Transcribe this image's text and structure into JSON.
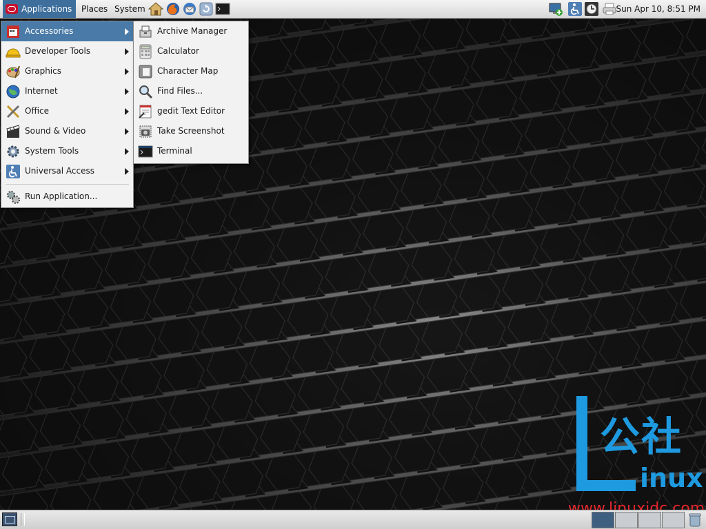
{
  "top_panel": {
    "applications_label": "Applications",
    "places_label": "Places",
    "system_label": "System",
    "launchers": [
      "home-folder-icon",
      "firefox-icon",
      "thunderbird-icon",
      "update-icon",
      "terminal-icon"
    ],
    "tray": [
      "network-icon",
      "accessibility-icon",
      "clock-icon",
      "printer-icon"
    ],
    "clock": "Sun Apr 10,  8:51 PM"
  },
  "applications_menu": {
    "items": [
      {
        "label": "Accessories",
        "icon": "accessories-icon",
        "selected": true
      },
      {
        "label": "Developer Tools",
        "icon": "developer-tools-icon"
      },
      {
        "label": "Graphics",
        "icon": "graphics-icon"
      },
      {
        "label": "Internet",
        "icon": "internet-icon"
      },
      {
        "label": "Office",
        "icon": "office-icon"
      },
      {
        "label": "Sound & Video",
        "icon": "sound-video-icon"
      },
      {
        "label": "System Tools",
        "icon": "system-tools-icon"
      },
      {
        "label": "Universal Access",
        "icon": "universal-access-icon"
      }
    ],
    "run_application": "Run Application..."
  },
  "accessories_submenu": {
    "items": [
      {
        "label": "Archive Manager",
        "icon": "archive-manager-icon"
      },
      {
        "label": "Calculator",
        "icon": "calculator-icon"
      },
      {
        "label": "Character Map",
        "icon": "character-map-icon"
      },
      {
        "label": "Find Files...",
        "icon": "find-files-icon"
      },
      {
        "label": "gedit Text Editor",
        "icon": "text-editor-icon"
      },
      {
        "label": "Take Screenshot",
        "icon": "screenshot-icon"
      },
      {
        "label": "Terminal",
        "icon": "terminal-icon"
      }
    ]
  },
  "watermark": {
    "chinese": "公社",
    "latin": "inux",
    "url": "www.linuxidc.com"
  },
  "colors": {
    "selection": "#4a7ba8",
    "watermark_blue": "#1e9ae0",
    "watermark_red": "#e3262b"
  }
}
